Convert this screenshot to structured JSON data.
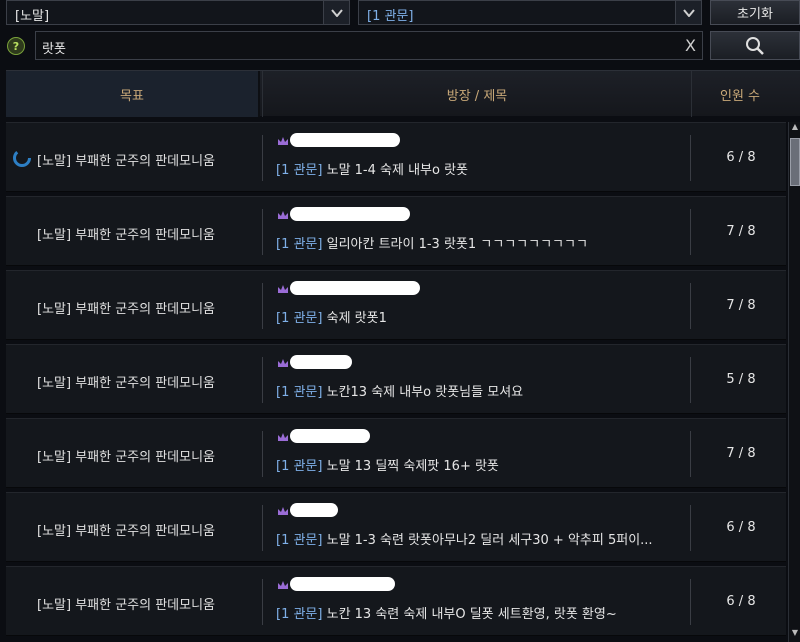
{
  "filters": {
    "difficulty": "[노말]",
    "gate": "[1 관문]",
    "reset_label": "초기화"
  },
  "search": {
    "help_symbol": "?",
    "value": "랏폿",
    "clear_symbol": "X"
  },
  "columns": {
    "goal": "목표",
    "title": "방장 / 제목",
    "count": "인원 수"
  },
  "rows": [
    {
      "goal": "[노말] 부패한 군주의 판데모니움",
      "gate": "[1 관문]",
      "title": "노말 1-4 숙제 내부o 랏폿",
      "count": "6 / 8"
    },
    {
      "goal": "[노말] 부패한 군주의 판데모니움",
      "gate": "[1 관문]",
      "title": "일리아칸 트라이 1-3 랏폿1 ㄱㄱㄱㄱㄱㄱㄱㄱㄱ",
      "count": "7 / 8"
    },
    {
      "goal": "[노말] 부패한 군주의 판데모니움",
      "gate": "[1 관문]",
      "title": "숙제 랏폿1",
      "count": "7 / 8"
    },
    {
      "goal": "[노말] 부패한 군주의 판데모니움",
      "gate": "[1 관문]",
      "title": "노칸13 숙제 내부o 랏폿님들 모셔요",
      "count": "5 / 8"
    },
    {
      "goal": "[노말] 부패한 군주의 판데모니움",
      "gate": "[1 관문]",
      "title": "노말 13 딜찍 숙제팟 16+ 랏폿",
      "count": "7 / 8"
    },
    {
      "goal": "[노말] 부패한 군주의 판데모니움",
      "gate": "[1 관문]",
      "title": "노말 1-3 숙련 랏폿아무나2 딜러 세구30 + 악추피 5퍼이...",
      "count": "6 / 8"
    },
    {
      "goal": "[노말] 부패한 군주의 판데모니움",
      "gate": "[1 관문]",
      "title": "노칸 13 숙련 숙제 내부O 딜폿 세트환영, 랏폿 환영~",
      "count": "6 / 8"
    }
  ]
}
